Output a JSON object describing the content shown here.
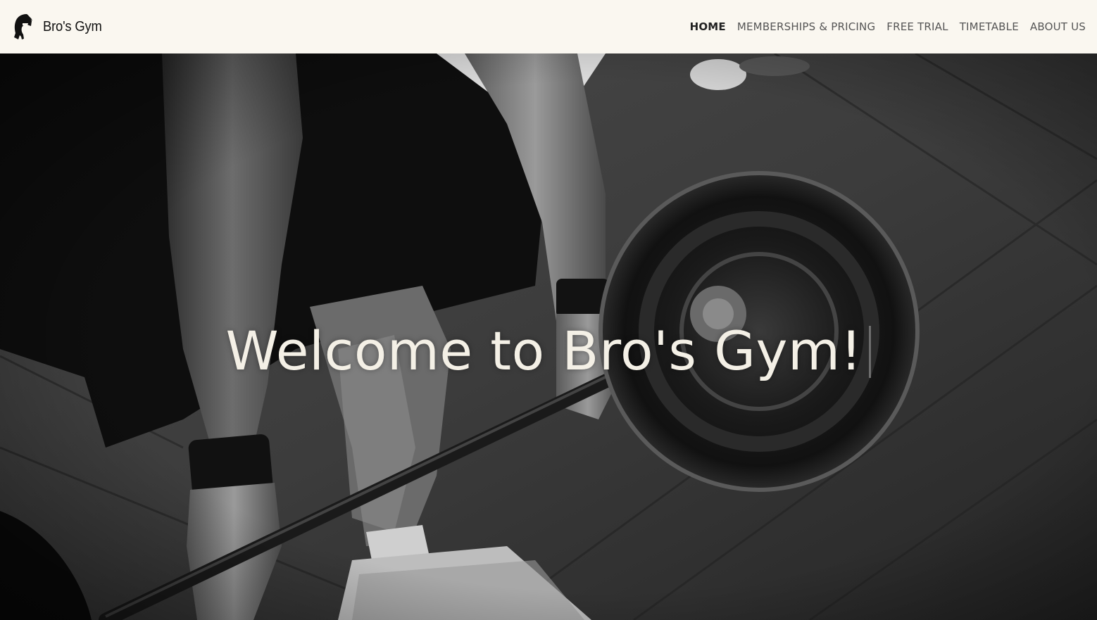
{
  "brand": {
    "logo_icon": "spartan-helmet-icon",
    "name": "Bro's Gym"
  },
  "nav": {
    "items": [
      {
        "label": "HOME",
        "active": true
      },
      {
        "label": "MEMBERSHIPS & PRICING",
        "active": false
      },
      {
        "label": "FREE TRIAL",
        "active": false
      },
      {
        "label": "TIMETABLE",
        "active": false
      },
      {
        "label": "ABOUT US",
        "active": false
      }
    ]
  },
  "hero": {
    "title": "Welcome to Bro's Gym!",
    "background": "black-and-white photo of a lifter gripping a loaded barbell"
  },
  "colors": {
    "navbar_bg": "#faf7f0",
    "nav_text": "#555555",
    "nav_active": "#222222",
    "hero_text": "#f4f0e6"
  }
}
